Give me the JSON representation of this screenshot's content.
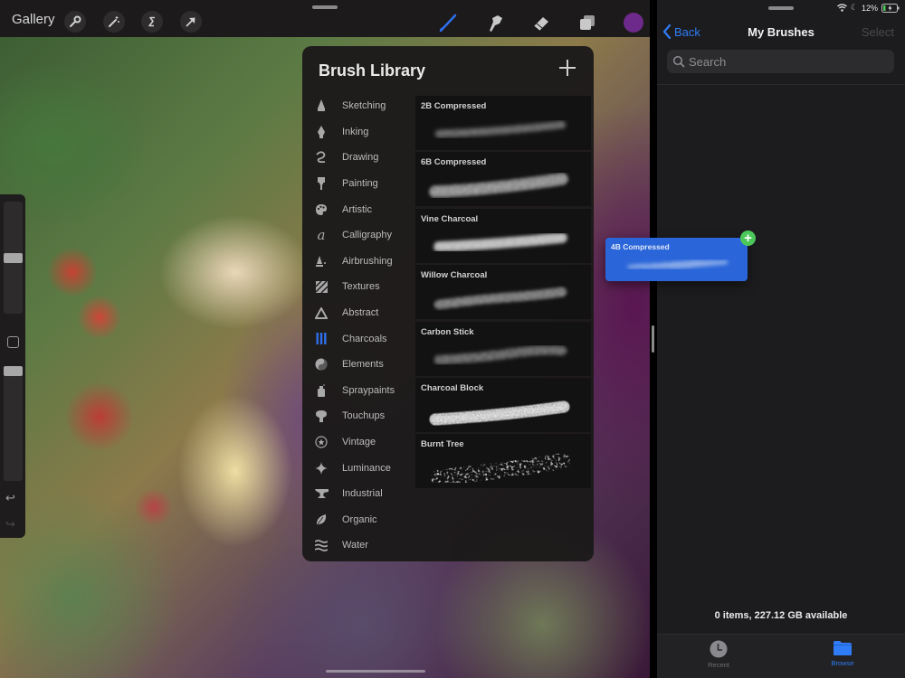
{
  "procreate": {
    "toolbar": {
      "gallery_label": "Gallery",
      "left_tools": [
        {
          "name": "actions",
          "icon": "wrench-icon"
        },
        {
          "name": "adjustments",
          "icon": "magic-wand-icon"
        },
        {
          "name": "selection",
          "icon": "selection-s-icon"
        },
        {
          "name": "transform",
          "icon": "arrow-cursor-icon"
        }
      ],
      "right_tools": [
        {
          "name": "brush",
          "icon": "brush-icon",
          "active": true
        },
        {
          "name": "smudge",
          "icon": "smudge-finger-icon",
          "active": false
        },
        {
          "name": "eraser",
          "icon": "eraser-icon",
          "active": false
        },
        {
          "name": "layers",
          "icon": "layers-icon",
          "active": false
        }
      ],
      "current_color": "#6e2a8a",
      "active_tool_color": "#2f6fec"
    },
    "sidebar": {
      "brush_size_fraction": 0.5,
      "opacity_fraction": 1.0
    },
    "brush_library": {
      "title": "Brush Library",
      "add_icon": "plus-icon",
      "categories": [
        {
          "label": "Sketching",
          "icon": "pencil-tip-icon"
        },
        {
          "label": "Inking",
          "icon": "pen-nib-icon"
        },
        {
          "label": "Drawing",
          "icon": "squiggle-icon"
        },
        {
          "label": "Painting",
          "icon": "paintbrush-icon"
        },
        {
          "label": "Artistic",
          "icon": "palette-icon"
        },
        {
          "label": "Calligraphy",
          "icon": "calligraphy-a-icon"
        },
        {
          "label": "Airbrushing",
          "icon": "airbrush-icon"
        },
        {
          "label": "Textures",
          "icon": "texture-hatch-icon"
        },
        {
          "label": "Abstract",
          "icon": "triangle-icon"
        },
        {
          "label": "Charcoals",
          "icon": "charcoal-sticks-icon",
          "active": true
        },
        {
          "label": "Elements",
          "icon": "yin-yang-icon"
        },
        {
          "label": "Spraypaints",
          "icon": "spray-can-icon"
        },
        {
          "label": "Touchups",
          "icon": "touchup-icon"
        },
        {
          "label": "Vintage",
          "icon": "star-badge-icon"
        },
        {
          "label": "Luminance",
          "icon": "sparkle-icon"
        },
        {
          "label": "Industrial",
          "icon": "anvil-icon"
        },
        {
          "label": "Organic",
          "icon": "leaf-icon"
        },
        {
          "label": "Water",
          "icon": "waves-icon"
        }
      ],
      "brushes": [
        {
          "name": "2B Compressed"
        },
        {
          "name": "6B Compressed"
        },
        {
          "name": "Vine Charcoal"
        },
        {
          "name": "Willow Charcoal"
        },
        {
          "name": "Carbon Stick"
        },
        {
          "name": "Charcoal Block"
        },
        {
          "name": "Burnt Tree"
        }
      ]
    },
    "dragged_brush": {
      "name": "4B Compressed",
      "badge": "+",
      "badge_color": "#4cc75a",
      "background": "#2a66d9"
    }
  },
  "files": {
    "status": {
      "battery": "12%",
      "wifi_icon": "wifi-icon",
      "dnd_icon": "moon-icon",
      "battery_icon": "battery-charging-icon"
    },
    "nav": {
      "back_label": "Back",
      "title": "My Brushes",
      "select_label": "Select"
    },
    "search": {
      "placeholder": "Search",
      "value": ""
    },
    "storage_info": "0 items, 227.12 GB available",
    "tabs": [
      {
        "label": "Recent",
        "icon": "clock-icon",
        "active": false
      },
      {
        "label": "Browse",
        "icon": "folder-icon",
        "active": true
      }
    ],
    "accent": "#2f7cf6"
  }
}
